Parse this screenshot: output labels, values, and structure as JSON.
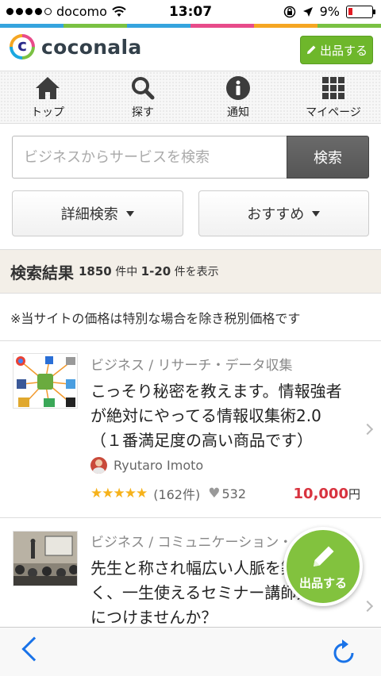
{
  "status": {
    "carrier": "docomo",
    "time": "13:07",
    "battery": "9%"
  },
  "brand_colors": [
    "#35a4de",
    "#7ac143",
    "#e84b8a",
    "#f5a623",
    "#35a4de",
    "#7ac143"
  ],
  "header": {
    "logo": "coconala",
    "sell_label": "出品する"
  },
  "nav": [
    {
      "label": "トップ",
      "icon": "home-icon"
    },
    {
      "label": "探す",
      "icon": "search-icon"
    },
    {
      "label": "通知",
      "icon": "info-icon"
    },
    {
      "label": "マイページ",
      "icon": "grid-icon"
    }
  ],
  "search": {
    "placeholder": "ビジネスからサービスを検索",
    "button": "検索"
  },
  "filters": {
    "detail": "詳細検索",
    "sort": "おすすめ"
  },
  "results": {
    "title": "検索結果",
    "total": "1850",
    "unit_of": "件中",
    "range": "1-20",
    "suffix": "件を表示"
  },
  "note": "※当サイトの価格は特別な場合を除き税別価格です",
  "listings": [
    {
      "category": "ビジネス / リサーチ・データ収集",
      "title": "こっそり秘密を教えます。情報強者が絶対にやってる情報収集術2.0（１番満足度の高い商品です）",
      "seller": "Ryutaro Imoto",
      "rating": 5,
      "stars": "★★★★★",
      "reviews": "(162件)",
      "favorites": "532",
      "price": "10,000",
      "currency": "円"
    },
    {
      "category": "ビジネス / コミュニケーション・",
      "title": "先生と称され幅広い人脈を築いていく、一生使えるセミナー講師力を身につけませんか？"
    }
  ],
  "fab": {
    "label": "出品する"
  }
}
